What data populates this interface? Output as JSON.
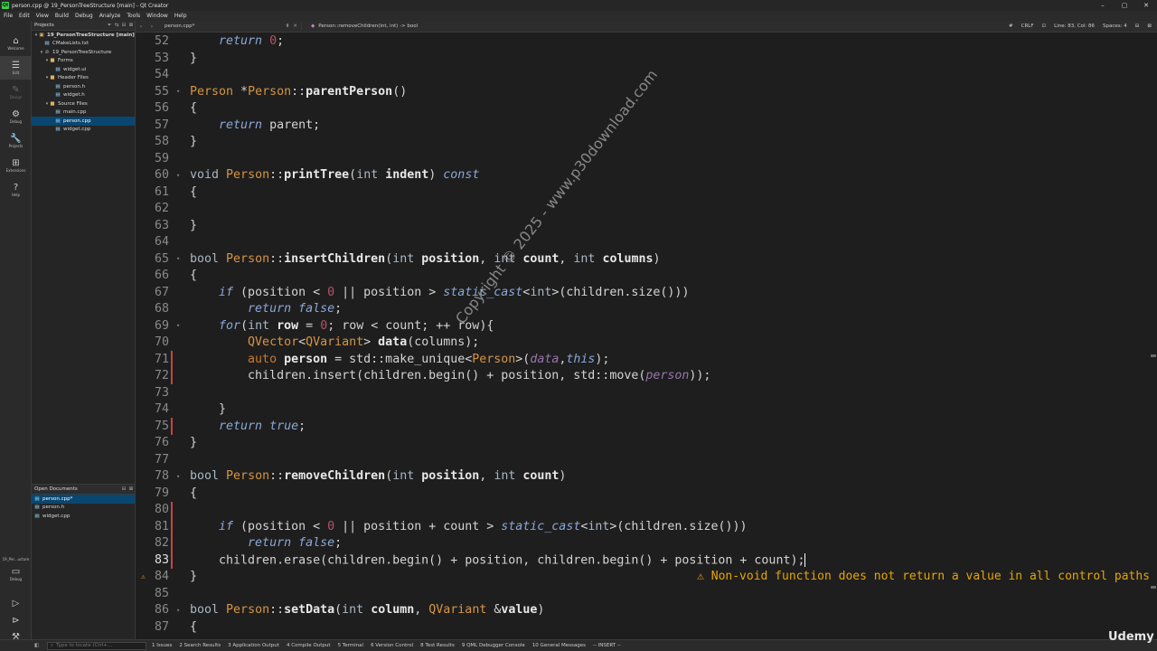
{
  "window": {
    "title": "person.cpp @ 19_PersonTreeStructure [main] - Qt Creator",
    "controls": [
      "–",
      "▢",
      "✕"
    ]
  },
  "menu": [
    "File",
    "Edit",
    "View",
    "Build",
    "Debug",
    "Analyze",
    "Tools",
    "Window",
    "Help"
  ],
  "modes": [
    {
      "label": "Welcome",
      "icon": "⌂"
    },
    {
      "label": "Edit",
      "icon": "☰"
    },
    {
      "label": "Design",
      "icon": "✎"
    },
    {
      "label": "Debug",
      "icon": "⚙"
    },
    {
      "label": "Projects",
      "icon": "🔧"
    },
    {
      "label": "Extensions",
      "icon": "⊞"
    },
    {
      "label": "Help",
      "icon": "?"
    }
  ],
  "kit": {
    "name": "19_Per...ucture",
    "mode": "Debug"
  },
  "projects": {
    "header": "Projects",
    "tree": [
      {
        "label": "19_PersonTreeStructure [main]",
        "type": "project"
      },
      {
        "label": "CMakeLists.txt",
        "type": "file"
      },
      {
        "label": "19_PersonTreeStructure",
        "type": "target"
      },
      {
        "label": "Forms",
        "type": "folder"
      },
      {
        "label": "widget.ui",
        "type": "file"
      },
      {
        "label": "Header Files",
        "type": "folder"
      },
      {
        "label": "person.h",
        "type": "file"
      },
      {
        "label": "widget.h",
        "type": "file"
      },
      {
        "label": "Source Files",
        "type": "folder"
      },
      {
        "label": "main.cpp",
        "type": "file"
      },
      {
        "label": "person.cpp",
        "type": "file"
      },
      {
        "label": "widget.cpp",
        "type": "file"
      }
    ]
  },
  "open_documents": {
    "header": "Open Documents",
    "items": [
      "person.cpp*",
      "person.h",
      "widget.cpp"
    ]
  },
  "editor_toolbar": {
    "document": "person.cpp*",
    "symbol": "Person::removeChildren(int, int) -> bool",
    "line_ending": "CRLF",
    "position": "Line: 83, Col: 86",
    "spaces": "Spaces: 4"
  },
  "code": [
    {
      "n": "52",
      "t": [
        [
          "    ",
          ""
        ],
        [
          "return",
          "kwi"
        ],
        [
          " ",
          ""
        ],
        [
          "0",
          "num"
        ],
        [
          ";",
          ""
        ]
      ]
    },
    {
      "n": "53",
      "t": [
        [
          "}",
          ""
        ]
      ]
    },
    {
      "n": "54",
      "t": []
    },
    {
      "n": "55",
      "t": [
        [
          "Person",
          "cl"
        ],
        [
          " *",
          ""
        ],
        [
          "Person",
          "cl"
        ],
        [
          "::",
          ""
        ],
        [
          "parentPerson",
          "fn"
        ],
        [
          "()",
          ""
        ]
      ]
    },
    {
      "n": "56",
      "t": [
        [
          "{",
          ""
        ]
      ]
    },
    {
      "n": "57",
      "t": [
        [
          "    ",
          ""
        ],
        [
          "return",
          "kwi"
        ],
        [
          " parent;",
          ""
        ]
      ]
    },
    {
      "n": "58",
      "t": [
        [
          "}",
          ""
        ]
      ]
    },
    {
      "n": "59",
      "t": []
    },
    {
      "n": "60",
      "t": [
        [
          "void",
          "kw"
        ],
        [
          " ",
          ""
        ],
        [
          "Person",
          "cl"
        ],
        [
          "::",
          ""
        ],
        [
          "printTree",
          "fn"
        ],
        [
          "(",
          ""
        ],
        [
          "int",
          "kw"
        ],
        [
          " ",
          ""
        ],
        [
          "indent",
          "pa"
        ],
        [
          ") ",
          ""
        ],
        [
          "const",
          "kwi"
        ]
      ]
    },
    {
      "n": "61",
      "t": [
        [
          "{",
          ""
        ]
      ]
    },
    {
      "n": "62",
      "t": []
    },
    {
      "n": "63",
      "t": [
        [
          "}",
          ""
        ]
      ]
    },
    {
      "n": "64",
      "t": []
    },
    {
      "n": "65",
      "t": [
        [
          "bool",
          "kw"
        ],
        [
          " ",
          ""
        ],
        [
          "Person",
          "cl"
        ],
        [
          "::",
          ""
        ],
        [
          "insertChildren",
          "fn"
        ],
        [
          "(",
          ""
        ],
        [
          "int",
          "kw"
        ],
        [
          " ",
          ""
        ],
        [
          "position",
          "pa"
        ],
        [
          ", ",
          ""
        ],
        [
          "int",
          "kw"
        ],
        [
          " ",
          ""
        ],
        [
          "count",
          "pa"
        ],
        [
          ", ",
          ""
        ],
        [
          "int",
          "kw"
        ],
        [
          " ",
          ""
        ],
        [
          "columns",
          "pa"
        ],
        [
          ")",
          ""
        ]
      ]
    },
    {
      "n": "66",
      "t": [
        [
          "{",
          ""
        ]
      ]
    },
    {
      "n": "67",
      "t": [
        [
          "    ",
          ""
        ],
        [
          "if",
          "kwi"
        ],
        [
          " (position < ",
          ""
        ],
        [
          "0",
          "num"
        ],
        [
          " || position > ",
          ""
        ],
        [
          "static_cast",
          "kwi"
        ],
        [
          "<",
          ""
        ],
        [
          "int",
          "kw"
        ],
        [
          ">(children.size()))",
          ""
        ]
      ]
    },
    {
      "n": "68",
      "t": [
        [
          "        ",
          ""
        ],
        [
          "return",
          "kwi"
        ],
        [
          " ",
          ""
        ],
        [
          "false",
          "kwi"
        ],
        [
          ";",
          ""
        ]
      ]
    },
    {
      "n": "69",
      "t": [
        [
          "    ",
          ""
        ],
        [
          "for",
          "kwi"
        ],
        [
          "(",
          ""
        ],
        [
          "int",
          "kw"
        ],
        [
          " ",
          ""
        ],
        [
          "row",
          "pa"
        ],
        [
          " = ",
          ""
        ],
        [
          "0",
          "num"
        ],
        [
          "; row < count; ++ row){",
          ""
        ]
      ]
    },
    {
      "n": "70",
      "t": [
        [
          "        ",
          ""
        ],
        [
          "QVector",
          "cl"
        ],
        [
          "<",
          ""
        ],
        [
          "QVariant",
          "cl"
        ],
        [
          "> ",
          ""
        ],
        [
          "data",
          "pa"
        ],
        [
          "(columns);",
          ""
        ]
      ]
    },
    {
      "n": "71",
      "t": [
        [
          "        ",
          ""
        ],
        [
          "auto",
          "kw2"
        ],
        [
          " ",
          ""
        ],
        [
          "person",
          "pa"
        ],
        [
          " = std::make_unique<",
          ""
        ],
        [
          "Person",
          "cl"
        ],
        [
          ">(",
          ""
        ],
        [
          "data",
          "it"
        ],
        [
          ",",
          ""
        ],
        [
          "this",
          "kwi"
        ],
        [
          ");",
          ""
        ]
      ]
    },
    {
      "n": "72",
      "t": [
        [
          "        children.insert(children.begin() + position, std::move(",
          ""
        ],
        [
          "person",
          "it"
        ],
        [
          "));",
          ""
        ]
      ]
    },
    {
      "n": "73",
      "t": []
    },
    {
      "n": "74",
      "t": [
        [
          "    }",
          ""
        ]
      ]
    },
    {
      "n": "75",
      "t": [
        [
          "    ",
          ""
        ],
        [
          "return",
          "kwi"
        ],
        [
          " ",
          ""
        ],
        [
          "true",
          "kwi"
        ],
        [
          ";",
          ""
        ]
      ]
    },
    {
      "n": "76",
      "t": [
        [
          "}",
          ""
        ]
      ]
    },
    {
      "n": "77",
      "t": []
    },
    {
      "n": "78",
      "t": [
        [
          "bool",
          "kw"
        ],
        [
          " ",
          ""
        ],
        [
          "Person",
          "cl"
        ],
        [
          "::",
          ""
        ],
        [
          "removeChildren",
          "fn"
        ],
        [
          "(",
          ""
        ],
        [
          "int",
          "kw"
        ],
        [
          " ",
          ""
        ],
        [
          "position",
          "pa"
        ],
        [
          ", ",
          ""
        ],
        [
          "int",
          "kw"
        ],
        [
          " ",
          ""
        ],
        [
          "count",
          "pa"
        ],
        [
          ")",
          ""
        ]
      ]
    },
    {
      "n": "79",
      "t": [
        [
          "{",
          ""
        ]
      ]
    },
    {
      "n": "80",
      "t": []
    },
    {
      "n": "81",
      "t": [
        [
          "    ",
          ""
        ],
        [
          "if",
          "kwi"
        ],
        [
          " (position < ",
          ""
        ],
        [
          "0",
          "num"
        ],
        [
          " || position + count > ",
          ""
        ],
        [
          "static_cast",
          "kwi"
        ],
        [
          "<",
          ""
        ],
        [
          "int",
          "kw"
        ],
        [
          ">(children.size()))",
          ""
        ]
      ]
    },
    {
      "n": "82",
      "t": [
        [
          "        ",
          ""
        ],
        [
          "return",
          "kwi"
        ],
        [
          " ",
          ""
        ],
        [
          "false",
          "kwi"
        ],
        [
          ";",
          ""
        ]
      ]
    },
    {
      "n": "83",
      "t": [
        [
          "    children.erase(children.begin() + position, children.begin() + position + count);",
          ""
        ]
      ]
    },
    {
      "n": "84",
      "t": [
        [
          "}",
          ""
        ]
      ]
    },
    {
      "n": "85",
      "t": []
    },
    {
      "n": "86",
      "t": [
        [
          "bool",
          "kw"
        ],
        [
          " ",
          ""
        ],
        [
          "Person",
          "cl"
        ],
        [
          "::",
          ""
        ],
        [
          "setData",
          "fn"
        ],
        [
          "(",
          ""
        ],
        [
          "int",
          "kw"
        ],
        [
          " ",
          ""
        ],
        [
          "column",
          "pa"
        ],
        [
          ", ",
          ""
        ],
        [
          "QVariant",
          "cl"
        ],
        [
          " &",
          ""
        ],
        [
          "value",
          "pa"
        ],
        [
          ")",
          ""
        ]
      ]
    },
    {
      "n": "87",
      "t": [
        [
          "{",
          ""
        ]
      ]
    }
  ],
  "warning": "⚠ Non-void function does not return a value in all control paths",
  "watermark": "Copyright © 2025 - www.p30download.com",
  "statusbar": {
    "locator_placeholder": "Type to locate (Ctrl+...",
    "panes": [
      "1 Issues",
      "2 Search Results",
      "3 Application Output",
      "4 Compile Output",
      "5 Terminal",
      "6 Version Control",
      "8 Test Results",
      "9 QML Debugger Console",
      "10 General Messages"
    ],
    "mode_text": "-- INSERT --"
  },
  "branding": "Udemy"
}
